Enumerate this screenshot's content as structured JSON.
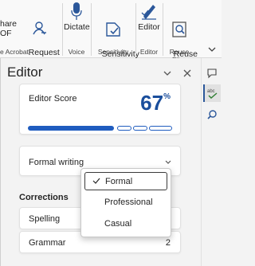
{
  "ribbon": {
    "buttons": [
      {
        "label": "hare\nOF"
      },
      {
        "label": "Request\nSignatures"
      },
      {
        "label": "Dictate"
      },
      {
        "label": "Sensitivity\n˅"
      },
      {
        "label": "Editor"
      },
      {
        "label": "Reuse\nFiles"
      }
    ],
    "groups": [
      "e Acrobat",
      "Voice",
      "Sensitivity",
      "Editor",
      "Reuse Files"
    ]
  },
  "pane": {
    "title": "Editor",
    "score_label": "Editor Score",
    "score_value": "67",
    "score_unit": "%",
    "score_fraction": 0.67,
    "writing_style": "Formal writing",
    "corrections_title": "Corrections",
    "corrections": [
      {
        "label": "Spelling",
        "count": ""
      },
      {
        "label": "Grammar",
        "count": "2"
      }
    ]
  },
  "dropdown": {
    "options": [
      {
        "label": "Formal",
        "selected": true
      },
      {
        "label": "Professional",
        "selected": false
      },
      {
        "label": "Casual",
        "selected": false
      }
    ]
  },
  "colors": {
    "accent": "#1f5cbf",
    "score": "#1a4e9c"
  },
  "icons": [
    "request-signatures-icon",
    "dictate-icon",
    "sensitivity-icon",
    "editor-icon",
    "reuse-files-icon",
    "comment-icon",
    "editor-check-icon",
    "search-icon",
    "dropdown-chevron-icon",
    "close-icon",
    "checkmark-icon"
  ]
}
